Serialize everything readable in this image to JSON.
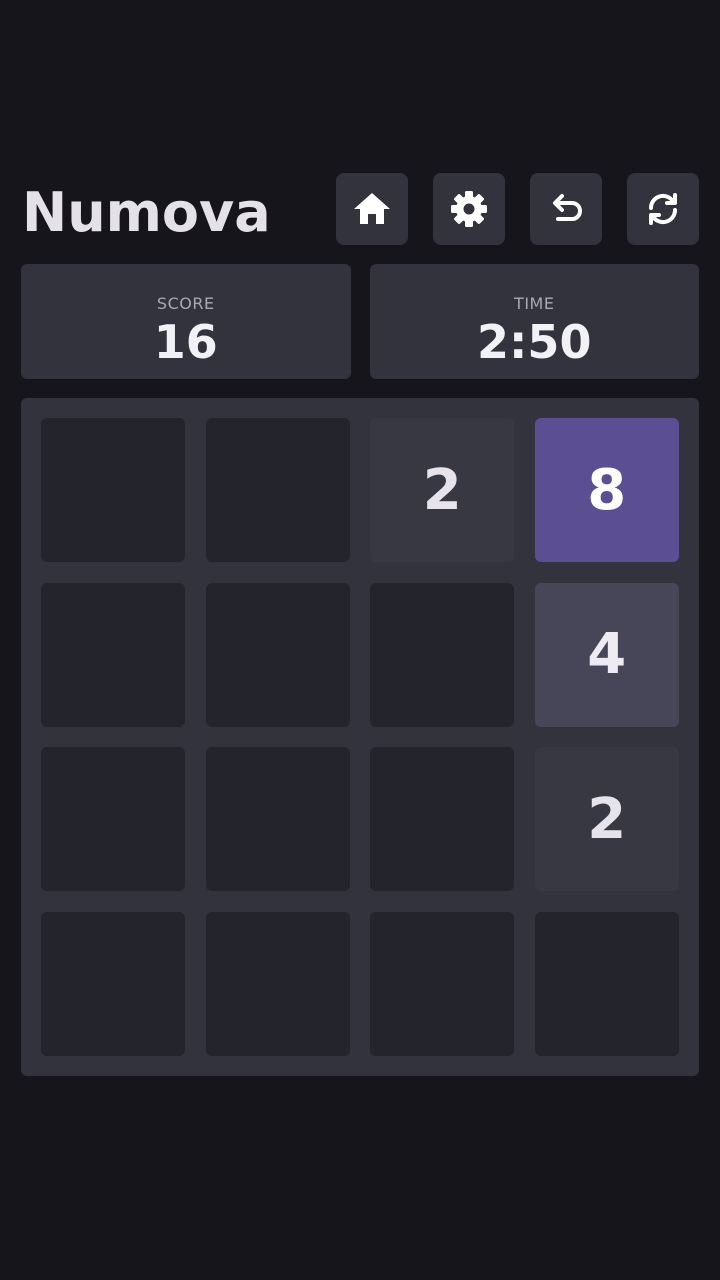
{
  "app": {
    "title": "Numova"
  },
  "toolbar": {
    "buttons": [
      {
        "name": "home-button",
        "icon": "home-icon"
      },
      {
        "name": "settings-button",
        "icon": "gear-icon"
      },
      {
        "name": "undo-button",
        "icon": "undo-icon"
      },
      {
        "name": "restart-button",
        "icon": "refresh-icon"
      }
    ]
  },
  "stats": {
    "score_label": "SCORE",
    "score_value": "16",
    "time_label": "TIME",
    "time_value": "2:50"
  },
  "board": {
    "rows": [
      [
        "",
        "",
        "2",
        "8"
      ],
      [
        "",
        "",
        "",
        "4"
      ],
      [
        "",
        "",
        "",
        "2"
      ],
      [
        "",
        "",
        "",
        ""
      ]
    ]
  },
  "colors": {
    "background": "#16151b",
    "panel": "#33333d",
    "empty_cell": "#24242d",
    "tile_2": "#383842",
    "tile_4": "#474658",
    "tile_8": "#5c4e93"
  }
}
